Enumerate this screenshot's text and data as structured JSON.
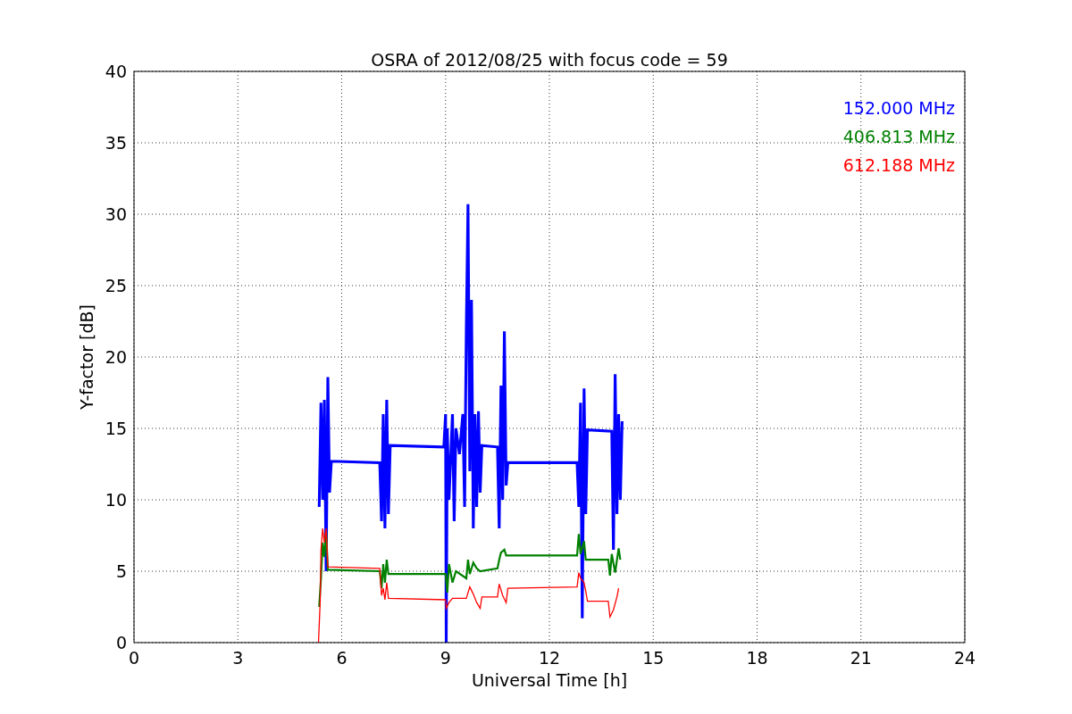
{
  "chart_data": {
    "type": "line",
    "title": "OSRA of 2012/08/25 with focus code = 59",
    "xlabel": "Universal Time [h]",
    "ylabel": "Y-factor [dB]",
    "xlim": [
      0,
      24
    ],
    "ylim": [
      0,
      40
    ],
    "xticks": [
      0,
      3,
      6,
      9,
      12,
      15,
      18,
      21,
      24
    ],
    "yticks": [
      0,
      5,
      10,
      15,
      20,
      25,
      30,
      35,
      40
    ],
    "grid": true,
    "series": [
      {
        "name": "152.000 MHz",
        "color": "#0000ff",
        "x": [
          5.35,
          5.4,
          5.45,
          5.5,
          5.55,
          5.6,
          5.65,
          5.7,
          7.1,
          7.15,
          7.2,
          7.25,
          7.3,
          7.35,
          7.4,
          8.95,
          9.0,
          9.02,
          9.05,
          9.1,
          9.2,
          9.25,
          9.3,
          9.4,
          9.5,
          9.55,
          9.6,
          9.65,
          9.7,
          9.75,
          9.8,
          9.85,
          9.9,
          9.95,
          10.0,
          10.05,
          10.5,
          10.55,
          10.6,
          10.65,
          10.7,
          10.75,
          10.8,
          12.8,
          12.85,
          12.9,
          12.95,
          13.0,
          13.05,
          13.1,
          13.8,
          13.85,
          13.9,
          13.95,
          14.0,
          14.05,
          14.1
        ],
        "values": [
          9.5,
          16.8,
          10,
          17,
          5,
          18.6,
          10.5,
          12.7,
          12.6,
          8.5,
          16,
          8,
          17,
          9,
          13.8,
          13.7,
          16,
          0,
          15,
          10,
          16,
          8.5,
          15,
          13.2,
          16,
          9.5,
          22,
          30.7,
          12,
          24,
          8,
          16,
          9.5,
          16.2,
          10.5,
          13.8,
          13.7,
          8,
          18,
          10,
          21.8,
          11,
          12.6,
          12.6,
          9.5,
          16.8,
          1.7,
          17.8,
          9,
          14.9,
          14.8,
          6.5,
          18.8,
          9,
          16,
          10,
          15.5
        ]
      },
      {
        "name": "406.813 MHz",
        "color": "#008000",
        "x": [
          5.35,
          5.4,
          5.45,
          5.5,
          5.55,
          5.6,
          7.1,
          7.15,
          7.2,
          7.25,
          7.3,
          7.35,
          9.0,
          9.05,
          9.1,
          9.2,
          9.3,
          9.6,
          9.65,
          9.7,
          9.8,
          9.9,
          10.0,
          10.5,
          10.55,
          10.6,
          10.7,
          10.75,
          12.8,
          12.85,
          12.9,
          13.0,
          13.05,
          13.1,
          13.7,
          13.75,
          13.8,
          13.9,
          14.0,
          14.05
        ],
        "values": [
          2.5,
          4.5,
          7,
          6,
          7.8,
          5.1,
          5.0,
          3.8,
          5.5,
          4.2,
          5.8,
          4.8,
          4.8,
          3.5,
          5.5,
          4.2,
          5.0,
          4.5,
          5.8,
          4.8,
          5.6,
          5.2,
          5.0,
          5.2,
          5.8,
          6.3,
          6.5,
          6.1,
          6.1,
          7.6,
          6.2,
          7.1,
          5.8,
          5.8,
          5.8,
          4.7,
          6.2,
          4.9,
          6.6,
          5.8
        ]
      },
      {
        "name": "612.188 MHz",
        "color": "#ff0000",
        "x": [
          5.33,
          5.38,
          5.4,
          5.45,
          5.5,
          5.55,
          5.6,
          7.1,
          7.15,
          7.2,
          7.25,
          7.3,
          7.35,
          9.0,
          9.02,
          9.1,
          9.2,
          9.6,
          9.7,
          9.8,
          9.9,
          10.0,
          10.05,
          10.5,
          10.55,
          10.65,
          10.75,
          10.8,
          12.8,
          12.85,
          12.9,
          13.0,
          13.05,
          13.1,
          13.7,
          13.75,
          13.85,
          13.95,
          14.0
        ],
        "values": [
          0,
          3,
          6.5,
          8,
          7,
          8,
          5.3,
          5.2,
          3.3,
          3.8,
          3.0,
          4.2,
          3.1,
          3.0,
          2.4,
          2.8,
          3.1,
          3.1,
          3.9,
          3.4,
          2.8,
          2.4,
          3.2,
          3.2,
          4.1,
          3.3,
          2.8,
          3.8,
          3.9,
          4.9,
          4.5,
          4.2,
          3.6,
          2.9,
          2.9,
          1.8,
          2.3,
          3.2,
          3.8
        ]
      }
    ]
  }
}
